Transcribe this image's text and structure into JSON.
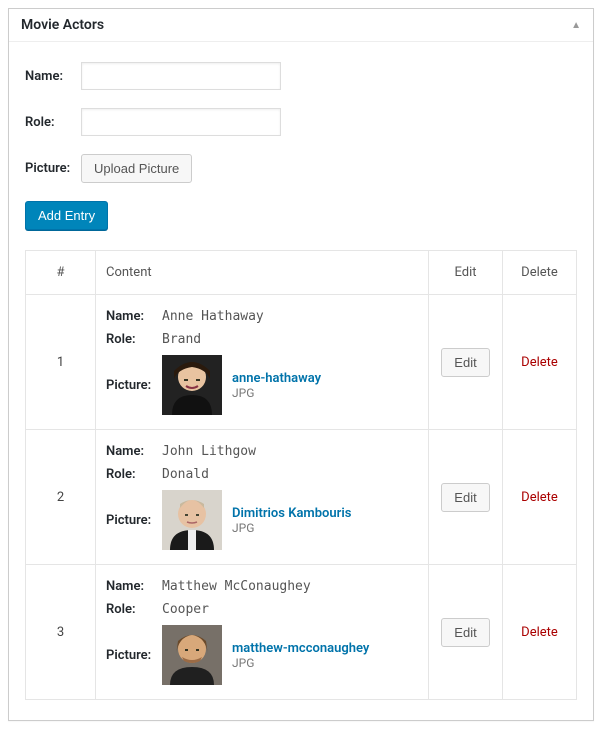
{
  "panel": {
    "title": "Movie Actors"
  },
  "form": {
    "name_label": "Name:",
    "role_label": "Role:",
    "picture_label": "Picture:",
    "upload_label": "Upload Picture",
    "add_entry_label": "Add Entry"
  },
  "table": {
    "headers": {
      "num": "#",
      "content": "Content",
      "edit": "Edit",
      "delete": "Delete"
    },
    "labels": {
      "name": "Name:",
      "role": "Role:",
      "picture": "Picture:",
      "edit_btn": "Edit",
      "delete_link": "Delete"
    },
    "rows": [
      {
        "num": "1",
        "name": "Anne Hathaway",
        "role": "Brand",
        "link_text": "anne-hathaway",
        "filetype": "JPG"
      },
      {
        "num": "2",
        "name": "John Lithgow",
        "role": "Donald",
        "link_text": "Dimitrios Kambouris",
        "filetype": "JPG"
      },
      {
        "num": "3",
        "name": "Matthew McConaughey",
        "role": "Cooper",
        "link_text": "matthew-mcconaughey",
        "filetype": "JPG"
      }
    ]
  }
}
